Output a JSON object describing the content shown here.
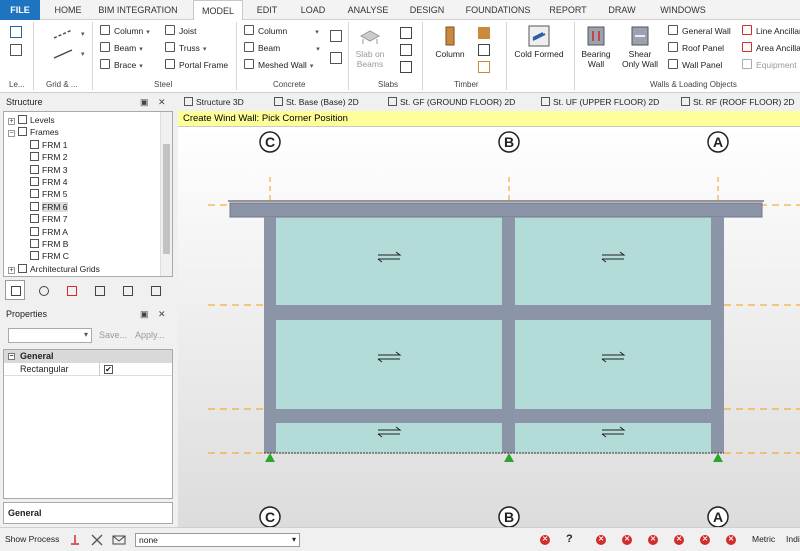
{
  "ribbon": {
    "tabs": [
      "FILE",
      "HOME",
      "BIM INTEGRATION",
      "MODEL",
      "EDIT",
      "LOAD",
      "ANALYSE",
      "DESIGN",
      "FOUNDATIONS",
      "REPORT",
      "DRAW",
      "WINDOWS"
    ],
    "active_tab": "MODEL",
    "groups": {
      "levels": "Le...",
      "grid": "Grid & ...",
      "steel": "Steel",
      "concrete": "Concrete",
      "slabs": "Slabs",
      "timber": "Timber",
      "walls": "Walls & Loading Objects"
    },
    "steel": {
      "column": "Column",
      "beam": "Beam",
      "brace": "Brace",
      "joist": "Joist",
      "truss": "Truss",
      "portal_frame": "Portal Frame"
    },
    "concrete": {
      "column": "Column",
      "beam": "Beam",
      "meshed_wall": "Meshed Wall"
    },
    "slabs": {
      "slab_on_beams_1": "Slab on",
      "slab_on_beams_2": "Beams"
    },
    "timber": {
      "column": "Column"
    },
    "cold_formed": "Cold Formed",
    "walls": {
      "bearing_wall_1": "Bearing",
      "bearing_wall_2": "Wall",
      "shear_wall_1": "Shear",
      "shear_wall_2": "Only Wall",
      "general_wall": "General Wall",
      "roof_panel": "Roof Panel",
      "wall_panel": "Wall Panel",
      "line_ancillary": "Line Ancillary",
      "area_ancillary": "Area Ancillary",
      "equipment": "Equipment"
    }
  },
  "structure_panel": {
    "title": "Structure",
    "controls": [
      "▣",
      "✕"
    ],
    "tree": [
      {
        "label": "Levels",
        "level": 1,
        "expander": "+"
      },
      {
        "label": "Frames",
        "level": 1,
        "expander": "−"
      },
      {
        "label": "FRM 1",
        "level": 2
      },
      {
        "label": "FRM 2",
        "level": 2
      },
      {
        "label": "FRM 3",
        "level": 2
      },
      {
        "label": "FRM 4",
        "level": 2
      },
      {
        "label": "FRM 5",
        "level": 2
      },
      {
        "label": "FRM 6",
        "level": 2,
        "selected": true
      },
      {
        "label": "FRM 7",
        "level": 2
      },
      {
        "label": "FRM A",
        "level": 2
      },
      {
        "label": "FRM B",
        "level": 2
      },
      {
        "label": "FRM C",
        "level": 2
      },
      {
        "label": "Architectural Grids",
        "level": 1,
        "expander": "+"
      }
    ]
  },
  "properties_panel": {
    "title": "Properties",
    "controls": [
      "▣",
      "✕"
    ],
    "save": "Save...",
    "apply": "Apply...",
    "category": "General",
    "row_label": "Rectangular",
    "row_checked": "✔",
    "description": "General"
  },
  "view_tabs": [
    "Structure 3D",
    "St. Base (Base) 2D",
    "St. GF (GROUND FLOOR) 2D",
    "St. UF (UPPER FLOOR) 2D",
    "St. RF (ROOF FLOOR) 2D"
  ],
  "prompt": "Create Wind Wall: Pick Corner Position",
  "canvas": {
    "grid_labels": [
      "C",
      "B",
      "A"
    ],
    "accent": "#f39c12",
    "frame_color": "#8c94a8",
    "panel_color": "#b3dcd8"
  },
  "status": {
    "show_process": "Show Process",
    "input_value": "none",
    "help": "?",
    "units": "Metric",
    "trailing": "Indi"
  }
}
